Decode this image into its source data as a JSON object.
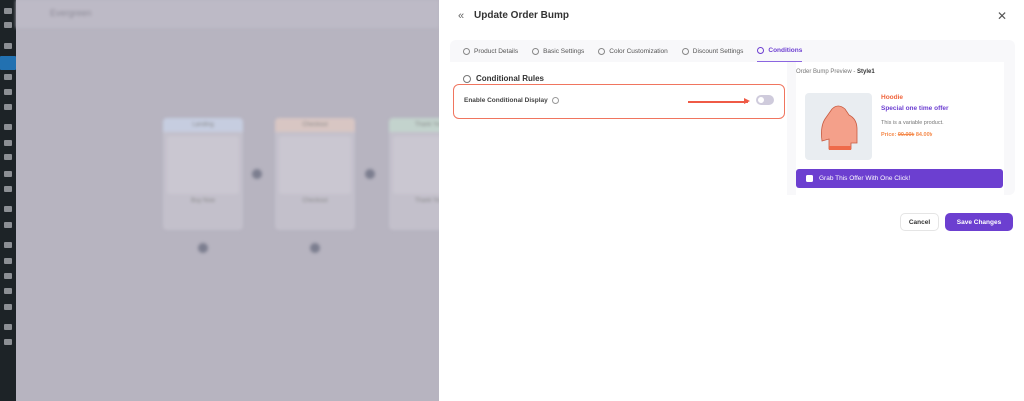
{
  "background": {
    "title": "Evergreen",
    "nodes": [
      {
        "header": "Landing",
        "name": "Buy Now",
        "color": "#c6cde0"
      },
      {
        "header": "Checkout",
        "name": "Checkout",
        "color": "#d8c6c3"
      },
      {
        "header": "Thank You",
        "name": "Thank You",
        "color": "#c3d3cd"
      }
    ]
  },
  "modal": {
    "title": "Update Order Bump",
    "tabs": [
      {
        "label": "Product Details",
        "active": false
      },
      {
        "label": "Basic Settings",
        "active": false
      },
      {
        "label": "Color Customization",
        "active": false
      },
      {
        "label": "Discount Settings",
        "active": false
      },
      {
        "label": "Conditions",
        "active": true
      }
    ],
    "section_title": "Conditional Rules",
    "toggle_label": "Enable Conditional Display",
    "toggle_on": false,
    "preview": {
      "label": "Order Bump Preview - ",
      "style": "Style1",
      "product_name": "Hoodie",
      "offer": "Special one time offer",
      "description": "This is a variable product.",
      "price_label": "Price: ",
      "old_price": "90.00৳",
      "new_price": "84.00৳",
      "cta": "Grab This Offer With One Click!"
    },
    "cancel": "Cancel",
    "save": "Save Changes",
    "accent": "#6c3fd0",
    "highlight": "#f0755f"
  }
}
